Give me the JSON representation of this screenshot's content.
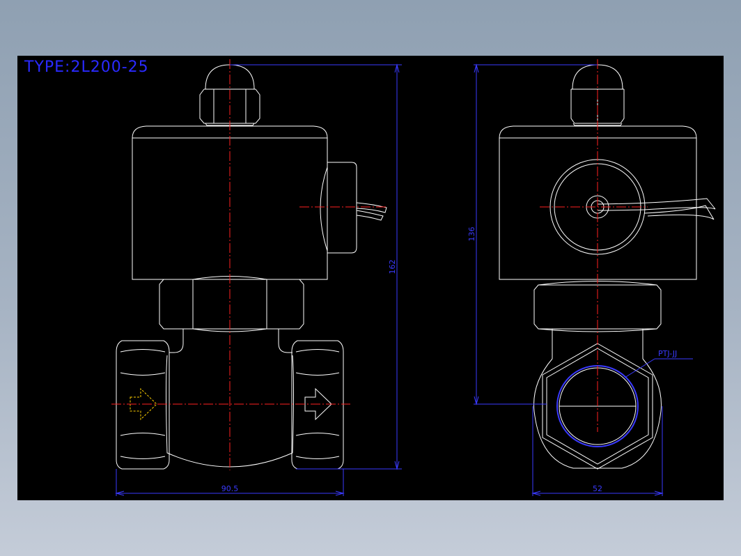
{
  "drawing": {
    "title": "TYPE:2L200-25",
    "dimensions": {
      "overall_height": "162",
      "coil_height": "136",
      "body_width_front": "90.5",
      "body_width_side": "52",
      "thread_callout": "PTJ-JJ"
    }
  }
}
